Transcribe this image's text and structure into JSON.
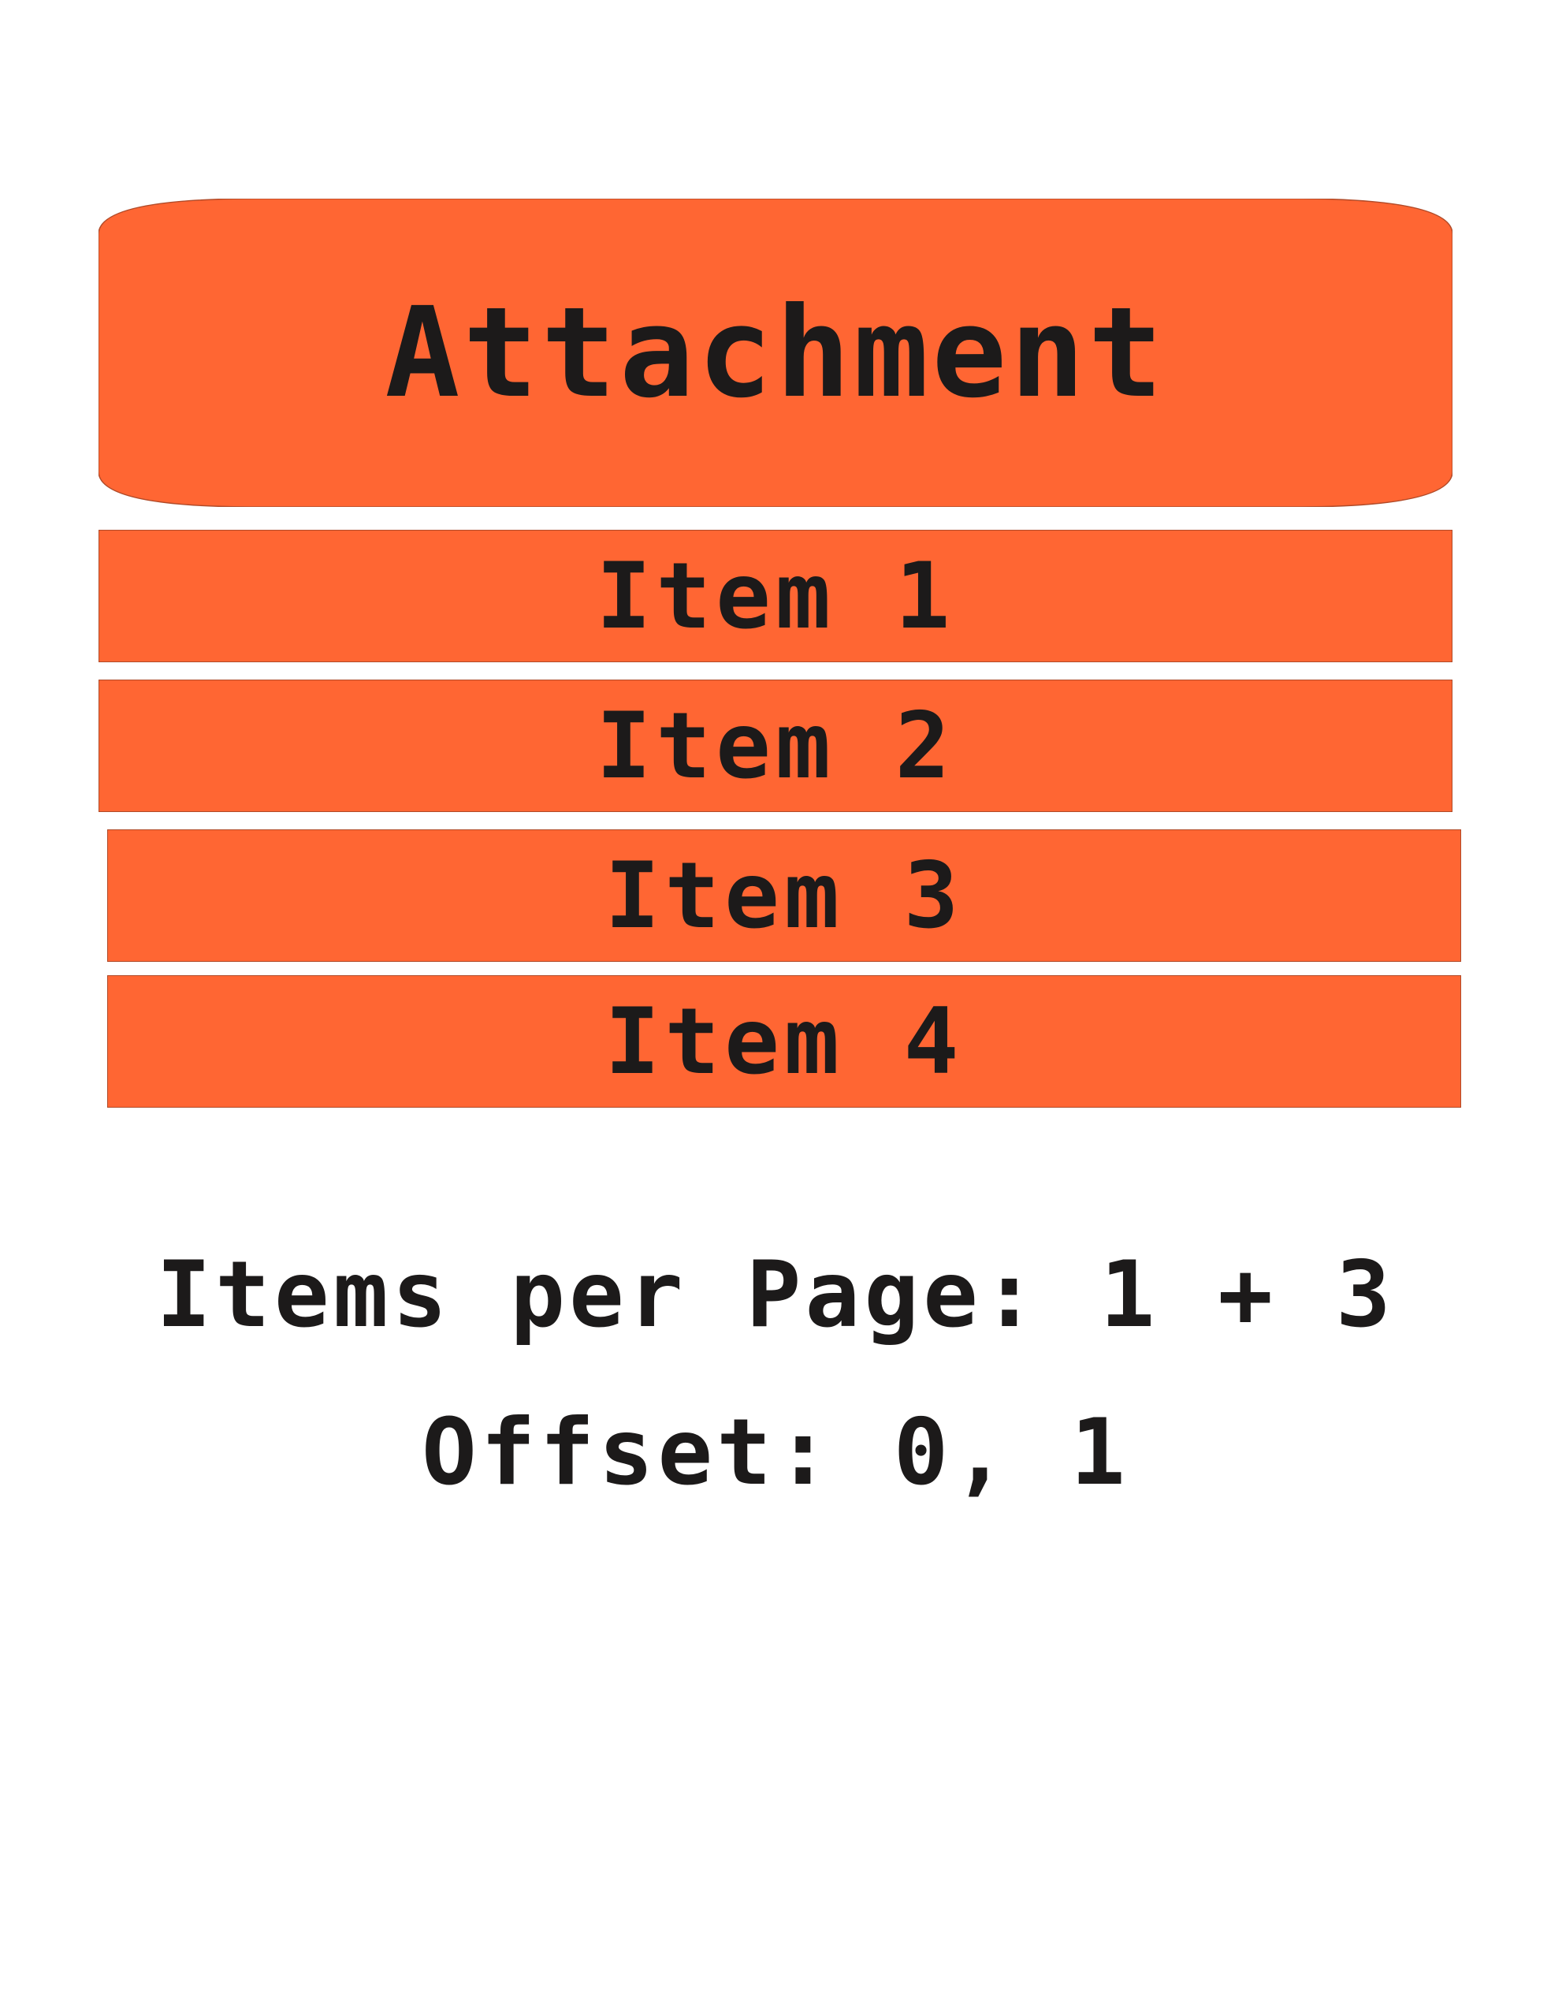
{
  "attachment": {
    "label": "Attachment"
  },
  "items": [
    {
      "label": "Item 1"
    },
    {
      "label": "Item 2"
    },
    {
      "label": "Item 3"
    },
    {
      "label": "Item 4"
    }
  ],
  "captions": {
    "items_per_page": "Items per Page: 1 + 3",
    "offset": "Offset: 0, 1"
  },
  "colors": {
    "fill": "#ff6633",
    "text": "#1c1a1a",
    "background": "#ffffff"
  }
}
